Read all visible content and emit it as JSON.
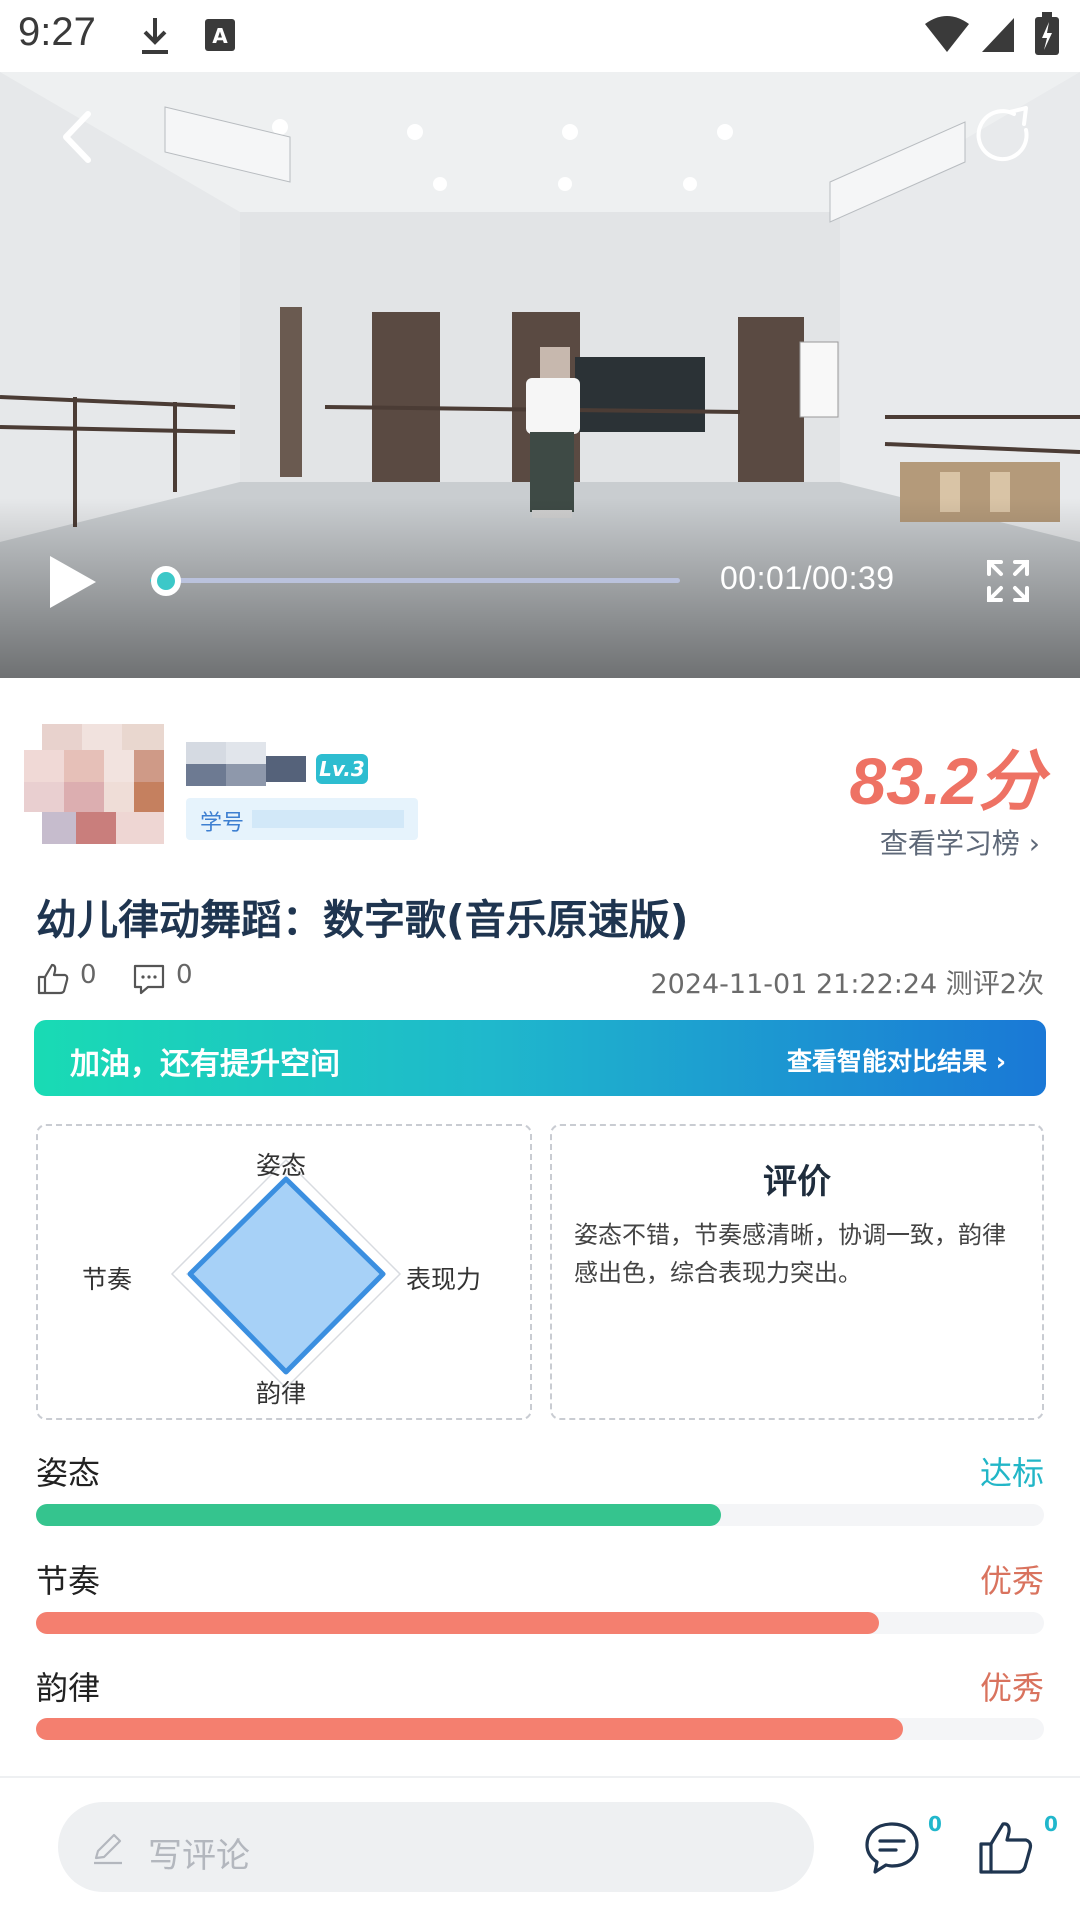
{
  "status_bar": {
    "time": "9:27",
    "icons": [
      "download-icon",
      "keyboard-a-icon",
      "wifi-icon",
      "signal-icon",
      "battery-charging-icon"
    ]
  },
  "video": {
    "current_time": "00:01",
    "duration": "00:39",
    "time_display": "00:01/00:39",
    "progress": 0.03,
    "icons": [
      "back-icon",
      "share-icon",
      "play-icon",
      "fullscreen-icon"
    ]
  },
  "user": {
    "level_badge": "Lv.3",
    "student_id_label": "学号"
  },
  "score": {
    "value": "83.2分",
    "rank_link": "查看学习榜 ›"
  },
  "video_title": "幼儿律动舞蹈：数字歌(音乐原速版)",
  "meta": {
    "likes": "0",
    "comments": "0",
    "date_info": "2024-11-01 21:22:24 测评2次"
  },
  "banner": {
    "text": "加油，还有提升空间",
    "link": "查看智能对比结果 ›",
    "colors": [
      "#19dbb4",
      "#1a78d6"
    ]
  },
  "radar": {
    "labels": {
      "top": "姿态",
      "right": "表现力",
      "bottom": "韵律",
      "left": "节奏"
    },
    "values": {
      "top": 0.95,
      "right": 0.97,
      "bottom": 0.98,
      "left": 0.96
    }
  },
  "evaluation": {
    "title": "评价",
    "text": "姿态不错，节奏感清晰，协调一致，韵律感出色，综合表现力突出。"
  },
  "metrics": [
    {
      "name": "姿态",
      "level": "达标",
      "value": 0.68,
      "color": "#35c48e",
      "level_color": "#22b6c7"
    },
    {
      "name": "节奏",
      "level": "优秀",
      "value": 0.836,
      "color": "#f47f6f",
      "level_color": "#d9735e"
    },
    {
      "name": "韵律",
      "level": "优秀",
      "value": 0.86,
      "color": "#f47f6f",
      "level_color": "#d9735e"
    }
  ],
  "bottom_bar": {
    "comment_placeholder": "写评论",
    "comment_count": "0",
    "like_count": "0"
  }
}
